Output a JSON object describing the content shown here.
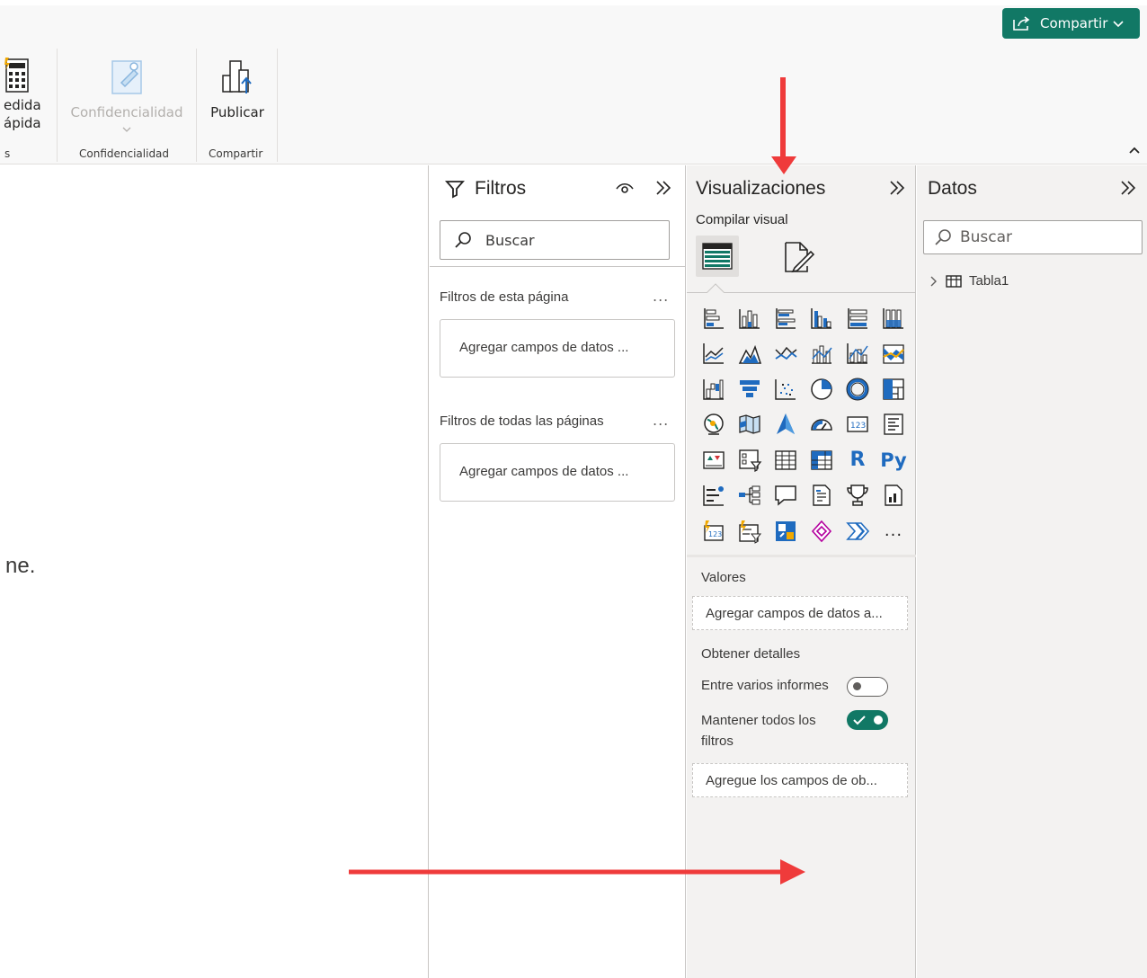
{
  "ribbon": {
    "share_button": "Compartir",
    "quick_measure_line1": "edida",
    "quick_measure_line2": "ápida",
    "calc_group_label": "s",
    "sensitivity_button": "Confidencialidad",
    "sensitivity_group_label": "Confidencialidad",
    "publish_button": "Publicar",
    "share_group_label": "Compartir"
  },
  "canvas": {
    "text": "ne."
  },
  "filters": {
    "title": "Filtros",
    "search_placeholder": "Buscar",
    "this_page_label": "Filtros de esta página",
    "this_page_well": "Agregar campos de datos ...",
    "all_pages_label": "Filtros de todas las páginas",
    "all_pages_well": "Agregar campos de datos ...",
    "more": "..."
  },
  "visualizations": {
    "title": "Visualizaciones",
    "subtitle": "Compilar visual",
    "values_label": "Valores",
    "values_well": "Agregar campos de datos a...",
    "drillthrough_label": "Obtener detalles",
    "cross_report_label": "Entre varios informes",
    "cross_report_on": false,
    "keep_filters_label_1": "Mantener todos los",
    "keep_filters_label_2": "filtros",
    "keep_filters_on": true,
    "drillthrough_well": "Agregue los campos de ob...",
    "more_visuals": "...",
    "r_visual": "R",
    "py_visual": "Py"
  },
  "data_pane": {
    "title": "Datos",
    "search_placeholder": "Buscar",
    "table_name": "Tabla1"
  },
  "colors": {
    "accent": "#117865",
    "annotation": "#ef3b3b"
  }
}
